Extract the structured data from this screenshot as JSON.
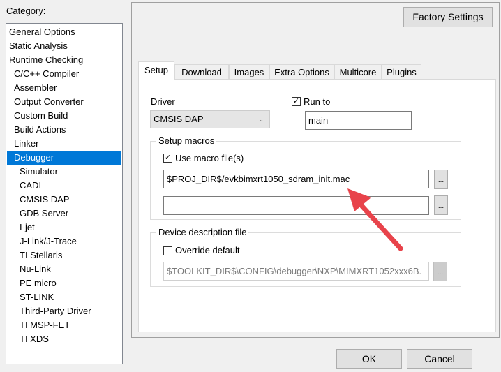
{
  "category": {
    "label": "Category:",
    "items": [
      {
        "label": "General Options",
        "level": 0
      },
      {
        "label": "Static Analysis",
        "level": 0
      },
      {
        "label": "Runtime Checking",
        "level": 0
      },
      {
        "label": "C/C++ Compiler",
        "level": 1
      },
      {
        "label": "Assembler",
        "level": 1
      },
      {
        "label": "Output Converter",
        "level": 1
      },
      {
        "label": "Custom Build",
        "level": 1
      },
      {
        "label": "Build Actions",
        "level": 1
      },
      {
        "label": "Linker",
        "level": 1
      },
      {
        "label": "Debugger",
        "level": 1,
        "selected": true
      },
      {
        "label": "Simulator",
        "level": 2
      },
      {
        "label": "CADI",
        "level": 2
      },
      {
        "label": "CMSIS DAP",
        "level": 2
      },
      {
        "label": "GDB Server",
        "level": 2
      },
      {
        "label": "I-jet",
        "level": 2
      },
      {
        "label": "J-Link/J-Trace",
        "level": 2
      },
      {
        "label": "TI Stellaris",
        "level": 2
      },
      {
        "label": "Nu-Link",
        "level": 2
      },
      {
        "label": "PE micro",
        "level": 2
      },
      {
        "label": "ST-LINK",
        "level": 2
      },
      {
        "label": "Third-Party Driver",
        "level": 2
      },
      {
        "label": "TI MSP-FET",
        "level": 2
      },
      {
        "label": "TI XDS",
        "level": 2
      }
    ]
  },
  "factory_settings": "Factory Settings",
  "tabs": [
    "Setup",
    "Download",
    "Images",
    "Extra Options",
    "Multicore",
    "Plugins"
  ],
  "setup": {
    "driver_label": "Driver",
    "driver_value": "CMSIS DAP",
    "run_to_label": "Run to",
    "run_to_checked": true,
    "run_to_value": "main",
    "macros_title": "Setup macros",
    "use_macro_label": "Use macro file(s)",
    "use_macro_checked": true,
    "macro_file_1": "$PROJ_DIR$/evkbimxrt1050_sdram_init.mac",
    "macro_file_2": "",
    "browse": "...",
    "device_title": "Device description file",
    "override_label": "Override default",
    "override_checked": false,
    "device_file": "$TOOLKIT_DIR$\\CONFIG\\debugger\\NXP\\MIMXRT1052xxx6B."
  },
  "ok": "OK",
  "cancel": "Cancel",
  "annotation_color": "#e8434b"
}
